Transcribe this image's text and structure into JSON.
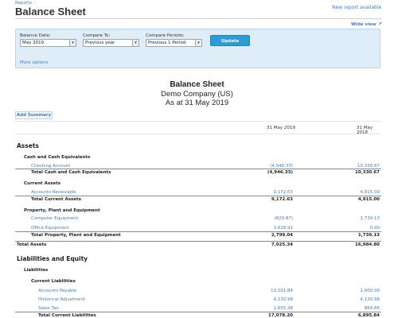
{
  "header": {
    "breadcrumb": "Reports",
    "breadcrumb_sep": "›",
    "title": "Balance Sheet",
    "new_report": "New report available"
  },
  "wide_view": "Wide view",
  "controls": {
    "balance_date_label": "Balance Date:",
    "balance_date_value": "May 2019",
    "compare_to_label": "Compare To:",
    "compare_to_value": "Previous year",
    "compare_periods_label": "Compare Periods:",
    "compare_periods_value": "Previous 1 Period",
    "update_label": "Update",
    "more_options": "More options"
  },
  "report": {
    "title": "Balance Sheet",
    "company": "Demo Company (US)",
    "as_at": "As at 31 May 2019",
    "add_summary": "Add Summary",
    "col1": "31 May 2019",
    "col2": "31 May 2018"
  },
  "rows": {
    "assets": "Assets",
    "cash_header": "Cash and Cash Equivalents",
    "checking": {
      "label": "Checking Account",
      "v1": "(4,946.33)",
      "v2": "10,330.67"
    },
    "total_cash": {
      "label": "Total Cash and Cash Equivalents",
      "v1": "(4,946.33)",
      "v2": "10,330.67"
    },
    "current_assets": "Current Assets",
    "ar": {
      "label": "Accounts Receivable",
      "v1": "9,172.63",
      "v2": "4,915.00"
    },
    "total_current_assets": {
      "label": "Total Current Assets",
      "v1": "9,172.63",
      "v2": "4,915.00"
    },
    "ppe_header": "Property, Plant and Equipment",
    "computer": {
      "label": "Computer Equipment",
      "v1": "(829.87)",
      "v2": "1,739.13"
    },
    "office": {
      "label": "Office Equipment",
      "v1": "3,628.91",
      "v2": "0.00"
    },
    "total_ppe": {
      "label": "Total Property, Plant and Equipment",
      "v1": "2,799.04",
      "v2": "1,739.13"
    },
    "total_assets": {
      "label": "Total Assets",
      "v1": "7,025.34",
      "v2": "16,984.80"
    },
    "liab_equity": "Liabilities and Equity",
    "liabilities": "Liabilities",
    "current_liabilities": "Current Liabilities",
    "ap": {
      "label": "Accounts Payable",
      "v1": "10,291.84",
      "v2": "1,900.00"
    },
    "hist": {
      "label": "Historical Adjustment",
      "v1": "4,130.98",
      "v2": "4,130.98"
    },
    "tax": {
      "label": "Sales Tax",
      "v1": "2,655.38",
      "v2": "864.86"
    },
    "total_current_liab": {
      "label": "Total Current Liabilities",
      "v1": "17,078.20",
      "v2": "6,895.84"
    }
  }
}
